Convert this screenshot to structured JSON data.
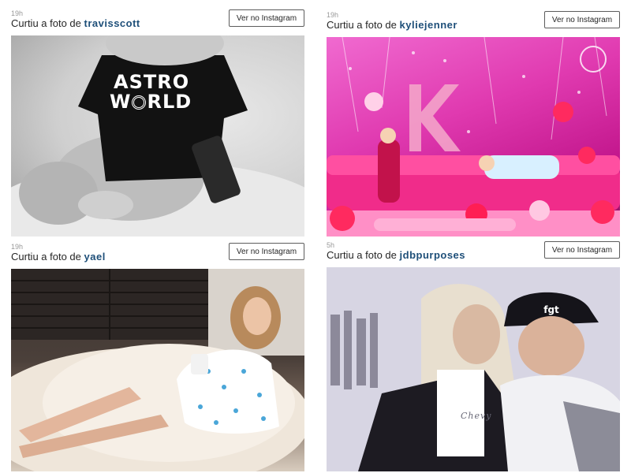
{
  "feed": {
    "cards": [
      {
        "time": "19h",
        "action_prefix": "Curtiu a foto de",
        "username": "travisscott",
        "button_label": "Ver no Instagram",
        "photo_text": [
          "ASTRO",
          "W",
          "RLD"
        ]
      },
      {
        "time": "19h",
        "action_prefix": "Curtiu a foto de",
        "username": "kyliejenner",
        "button_label": "Ver no Instagram"
      },
      {
        "time": "19h",
        "action_prefix": "Curtiu a foto de",
        "username": "yael",
        "button_label": "Ver no Instagram"
      },
      {
        "time": "5h",
        "action_prefix": "Curtiu a foto de",
        "username": "jdbpurposes",
        "button_label": "Ver no Instagram",
        "photo_text": [
          "Chevy"
        ]
      }
    ]
  },
  "colors": {
    "username": "#1e4f79",
    "timestamp": "#999999",
    "text": "#262626",
    "button_border": "#5c5c5c"
  }
}
